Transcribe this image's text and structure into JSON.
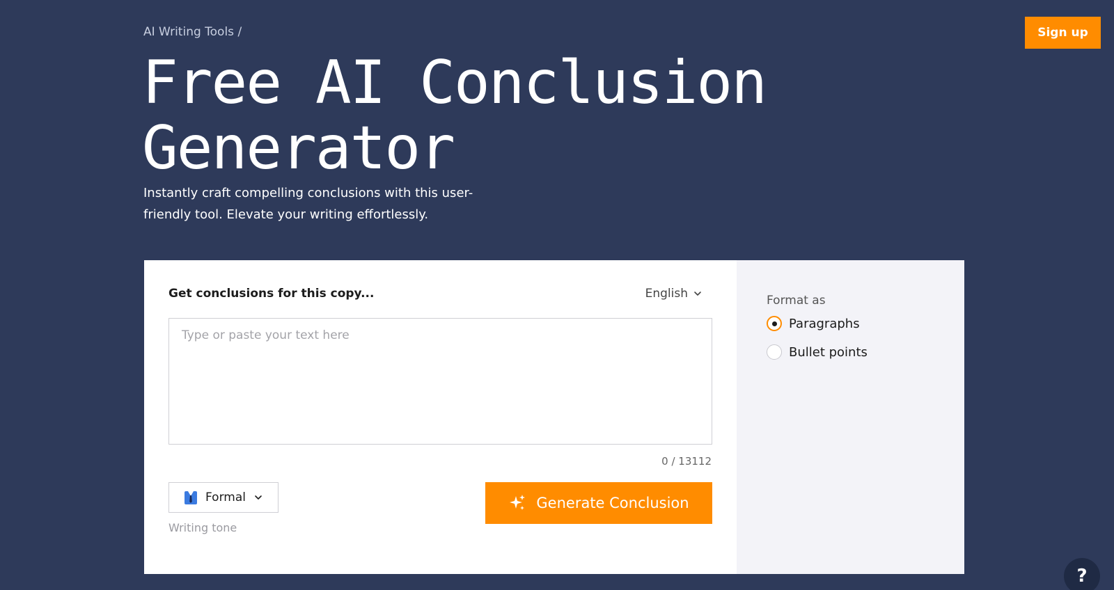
{
  "header": {
    "signup_label": "Sign up"
  },
  "hero": {
    "breadcrumb": "AI Writing Tools /",
    "title_line1": "Free AI Conclusion",
    "title_line2": "Generator",
    "subtitle": "Instantly craft compelling conclusions with this user-friendly tool. Elevate your writing effortlessly."
  },
  "tool": {
    "heading": "Get conclusions for this copy...",
    "language": "English",
    "input_placeholder": "Type or paste your text here",
    "input_value": "",
    "char_count": "0 / 13112",
    "tone": {
      "selected": "Formal",
      "label": "Writing tone"
    },
    "generate_label": "Generate Conclusion"
  },
  "format": {
    "title": "Format as",
    "options": [
      {
        "label": "Paragraphs",
        "checked": true
      },
      {
        "label": "Bullet points",
        "checked": false
      }
    ]
  },
  "help": {
    "label": "?"
  },
  "colors": {
    "background": "#2e3a5a",
    "accent": "#ff8c00",
    "side_panel": "#f3f3f8"
  }
}
